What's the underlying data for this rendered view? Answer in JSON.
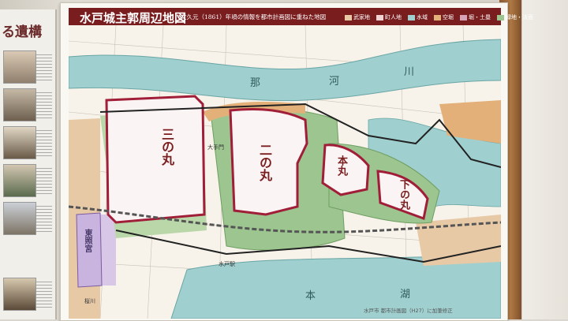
{
  "board": {
    "title": "水戸城主郭周辺地図",
    "subtitle": "文久元（1861）年頃の情報を都市計画図に重ねた地図"
  },
  "legend": [
    {
      "label": "武家地",
      "color": "#e7c9a6"
    },
    {
      "label": "町人地",
      "color": "#f1d3d3"
    },
    {
      "label": "水域",
      "color": "#9fcfcf"
    },
    {
      "label": "空堀",
      "color": "#e3b07a"
    },
    {
      "label": "堀・土塁",
      "color": "#d7a3b6"
    },
    {
      "label": "緑地・法面",
      "color": "#9cc58f"
    }
  ],
  "left_panel": {
    "title": "る遺構"
  },
  "map_labels": {
    "sannomaru": "三の丸",
    "ninomaru": "二の丸",
    "honmaru": "本丸",
    "shimonomaru": "下の丸",
    "toshogu": "東照宮",
    "river_1": "那",
    "river_2": "河",
    "river_3": "川",
    "lake_1": "湖",
    "lake_2": "本",
    "station": "水戸駅",
    "gate_1": "大手門",
    "gate_2": "桜川"
  },
  "footer": {
    "note": "水戸市 都市計画図（H27）に加筆修正"
  }
}
